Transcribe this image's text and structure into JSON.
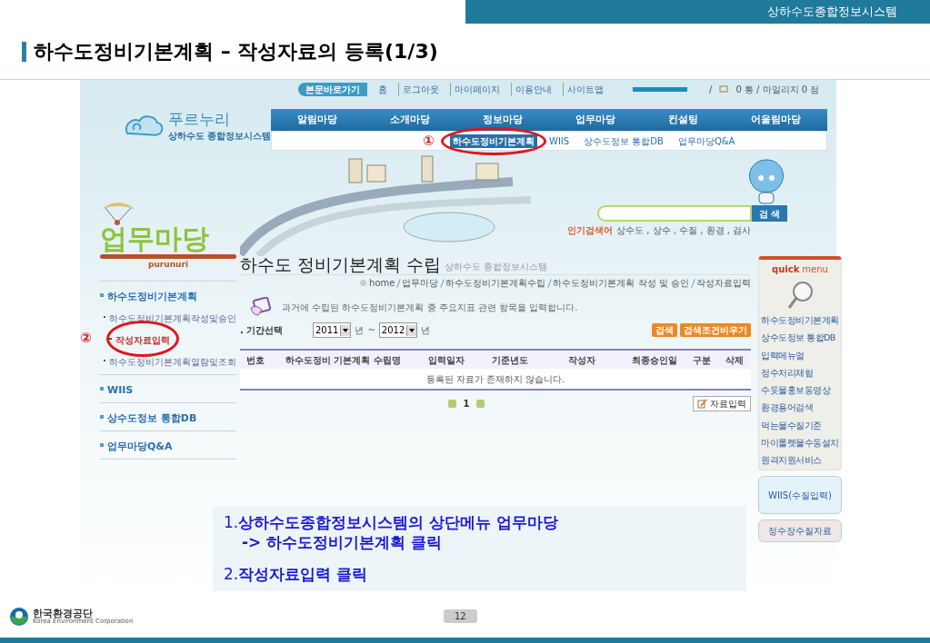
{
  "slide_header": {
    "system_name": "상하수도종합정보시스템",
    "title": "하수도정비기본계획 – 작성자료의 등록(1/3)"
  },
  "site": {
    "utility": {
      "skip_link": "본문바로가기",
      "links": [
        "홈",
        "로그아웃",
        "마이페이지",
        "이용안내",
        "사이트맵"
      ],
      "separator": "/",
      "status": "0 통 / 마일리지 0 점"
    },
    "logo": {
      "name": "푸르누리",
      "subtitle": "상하수도 종합정보시스템"
    },
    "nav": [
      "알림마당",
      "소개마당",
      "정보마당",
      "업무마당",
      "컨설팅",
      "어울림마당"
    ],
    "subnav": [
      {
        "label": "하수도정비기본계획",
        "selected": true
      },
      {
        "label": "WIIS",
        "selected": false
      },
      {
        "label": "상수도정보 통합DB",
        "selected": false
      },
      {
        "label": "업무마당Q&A",
        "selected": false
      }
    ],
    "search": {
      "button": "검 색",
      "popular_label": "인기검색어",
      "popular_terms": "상수도 , 상수 , 수질 , 환경 , 검사"
    },
    "section": {
      "title": "업무마당",
      "subtitle": "purunuri"
    },
    "sidebar": [
      {
        "label": "하수도정비기본계획",
        "selected": false,
        "children": [
          {
            "label": "하수도정비기본계획작성및승인",
            "selected": false,
            "children": [
              {
                "label": "작성자료입력",
                "selected": true
              }
            ]
          },
          {
            "label": "하수도정비기본계획열람및조회",
            "selected": false
          }
        ]
      },
      {
        "label": "WIIS",
        "selected": false
      },
      {
        "label": "상수도정보 통합DB",
        "selected": false
      },
      {
        "label": "업무마당Q&A",
        "selected": false
      }
    ],
    "page": {
      "title": "하수도 정비기본계획 수립",
      "title_note": "상하수도 종합정보시스템",
      "breadcrumb": [
        "home",
        "업무마당",
        "하수도정비기본계획수립",
        "하수도정비기본계획 작성 및 승인",
        "작성자료입력"
      ],
      "description": "과거에 수립된 하수도정비기본계획 중 주요지표 관련 항목을 입력합니다.",
      "period": {
        "label": ". 기간선택",
        "from": "2011",
        "to": "2012",
        "from_unit": "년",
        "separator": "~",
        "to_unit": "년"
      },
      "buttons": [
        "검색",
        "검색조건비우기"
      ],
      "table": {
        "columns": [
          "번호",
          "하수도정비 기본계획 수립명",
          "입력일자",
          "기준년도",
          "작성자",
          "최종승인일",
          "구분",
          "삭제"
        ],
        "empty_message": "등록된 자료가 존재하지 않습니다."
      },
      "pagination": [
        {
          "label": "1",
          "selected": true
        }
      ],
      "add_button": "자료입력"
    },
    "quick_menu": {
      "title": "quick",
      "title_suffix": "menu",
      "items": [
        "하수도정비기본계획",
        "상수도정보 통합DB",
        "입력메뉴얼",
        "정수처리체험",
        "수돗물홍보동영상",
        "환경용어검색",
        "먹는물수질기준",
        "마이룰렛물수동설치",
        "원격지원서비스"
      ],
      "banners": [
        "WIIS(수질입력)",
        "정수장수질자료"
      ]
    }
  },
  "annotations": {
    "markers": [
      "①",
      "②"
    ],
    "instructions": [
      {
        "lines": [
          "1.**상하수도종합정보시스템의 상단메뉴 업무마당**",
          "**-> 하수도정비기본계획 클릭**"
        ]
      },
      {
        "lines": [
          "2.**작성자료입력 클릭**"
        ]
      }
    ]
  },
  "footer": {
    "org": "한국환경공단",
    "org_en": "Korea Environment Corporation",
    "page": "12"
  }
}
